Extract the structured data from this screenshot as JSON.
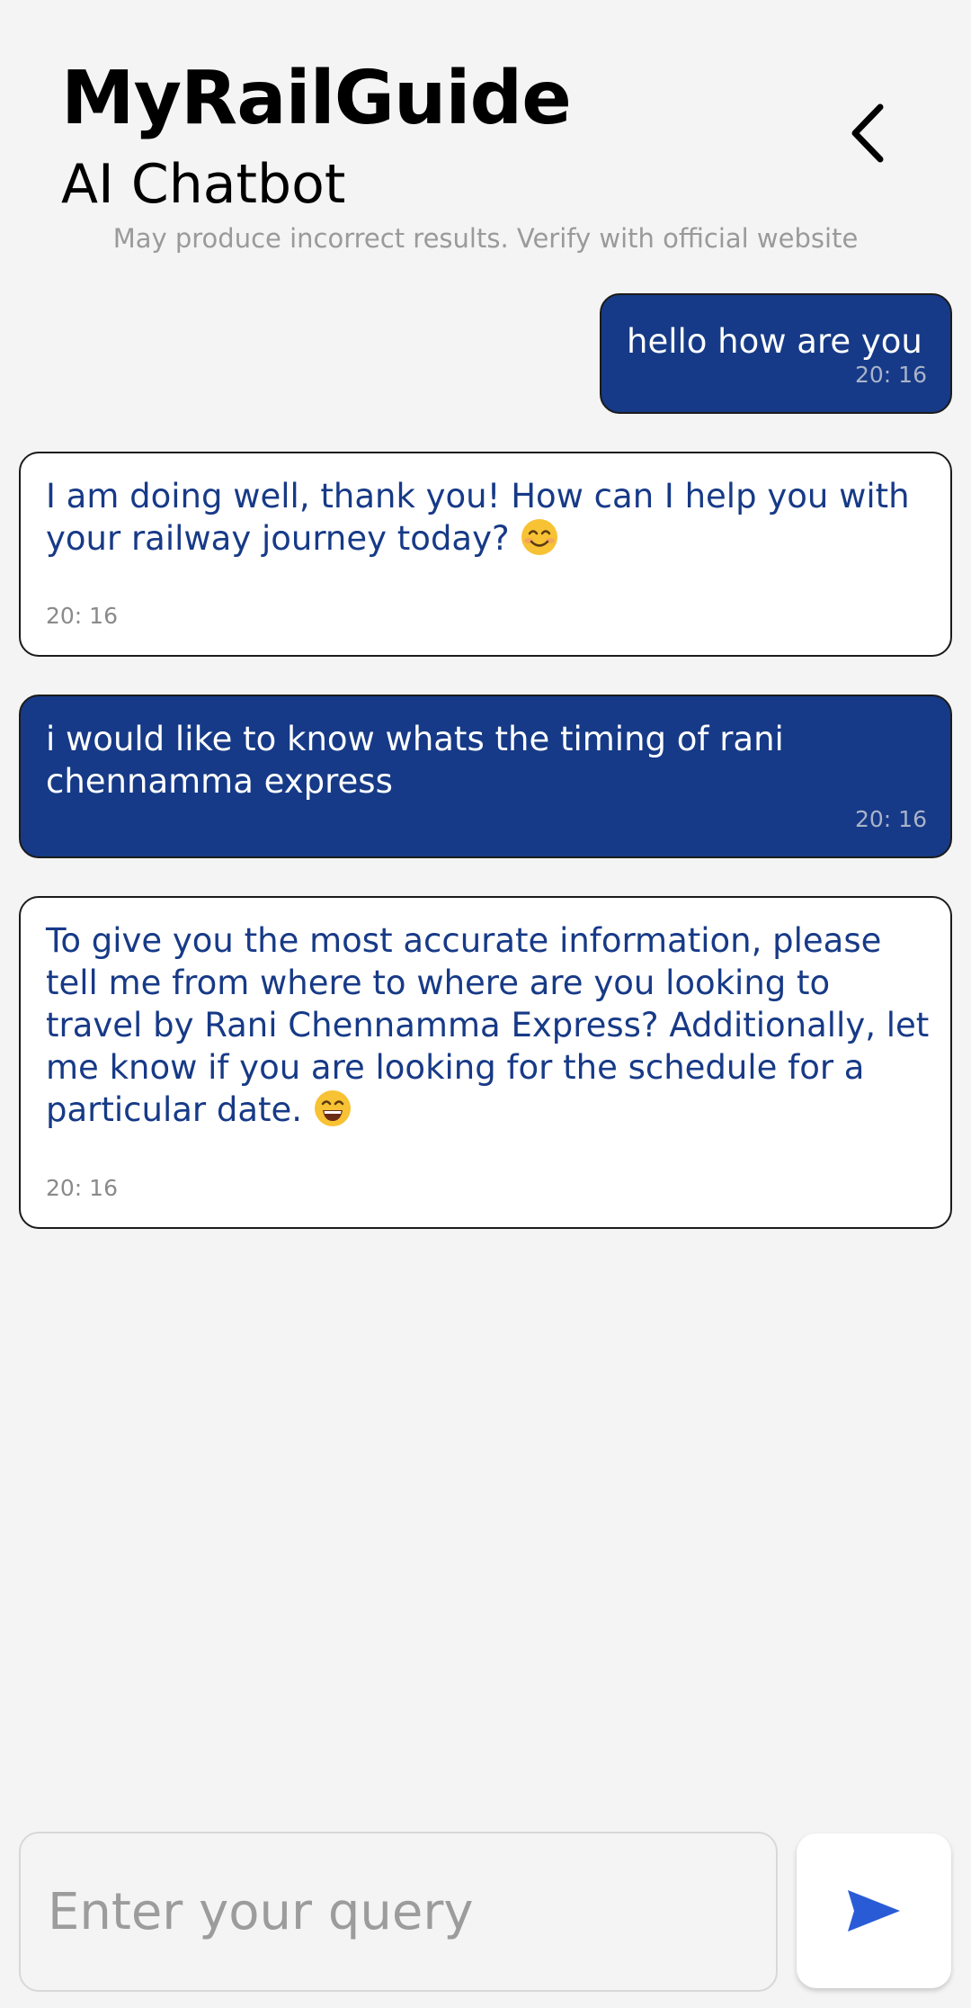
{
  "header": {
    "app_title": "MyRailGuide",
    "subtitle": "AI Chatbot",
    "disclaimer": "May produce incorrect results. Verify with official website",
    "back_icon": "chevron-left-icon"
  },
  "messages": [
    {
      "sender": "user",
      "text": "hello how are you",
      "time": "20: 16"
    },
    {
      "sender": "bot",
      "text": "I am doing well, thank you! How can I help you with your railway journey today?",
      "emoji": "smiling-face-icon",
      "time": "20: 16"
    },
    {
      "sender": "user",
      "text": "i would like to know whats the timing of rani chennamma express",
      "time": "20: 16"
    },
    {
      "sender": "bot",
      "text": "To give you the most accurate information, please tell me from where to where are you looking to travel by Rani Chennamma Express? Additionally, let me know if you are looking for the schedule for a particular date.",
      "emoji": "grinning-face-icon",
      "time": "20: 16"
    }
  ],
  "composer": {
    "placeholder": "Enter your query",
    "value": "",
    "send_icon": "send-icon"
  },
  "colors": {
    "background": "#f4f4f4",
    "user_bubble": "#163a87",
    "bot_text": "#173a87",
    "send_icon": "#2a5bd7"
  }
}
